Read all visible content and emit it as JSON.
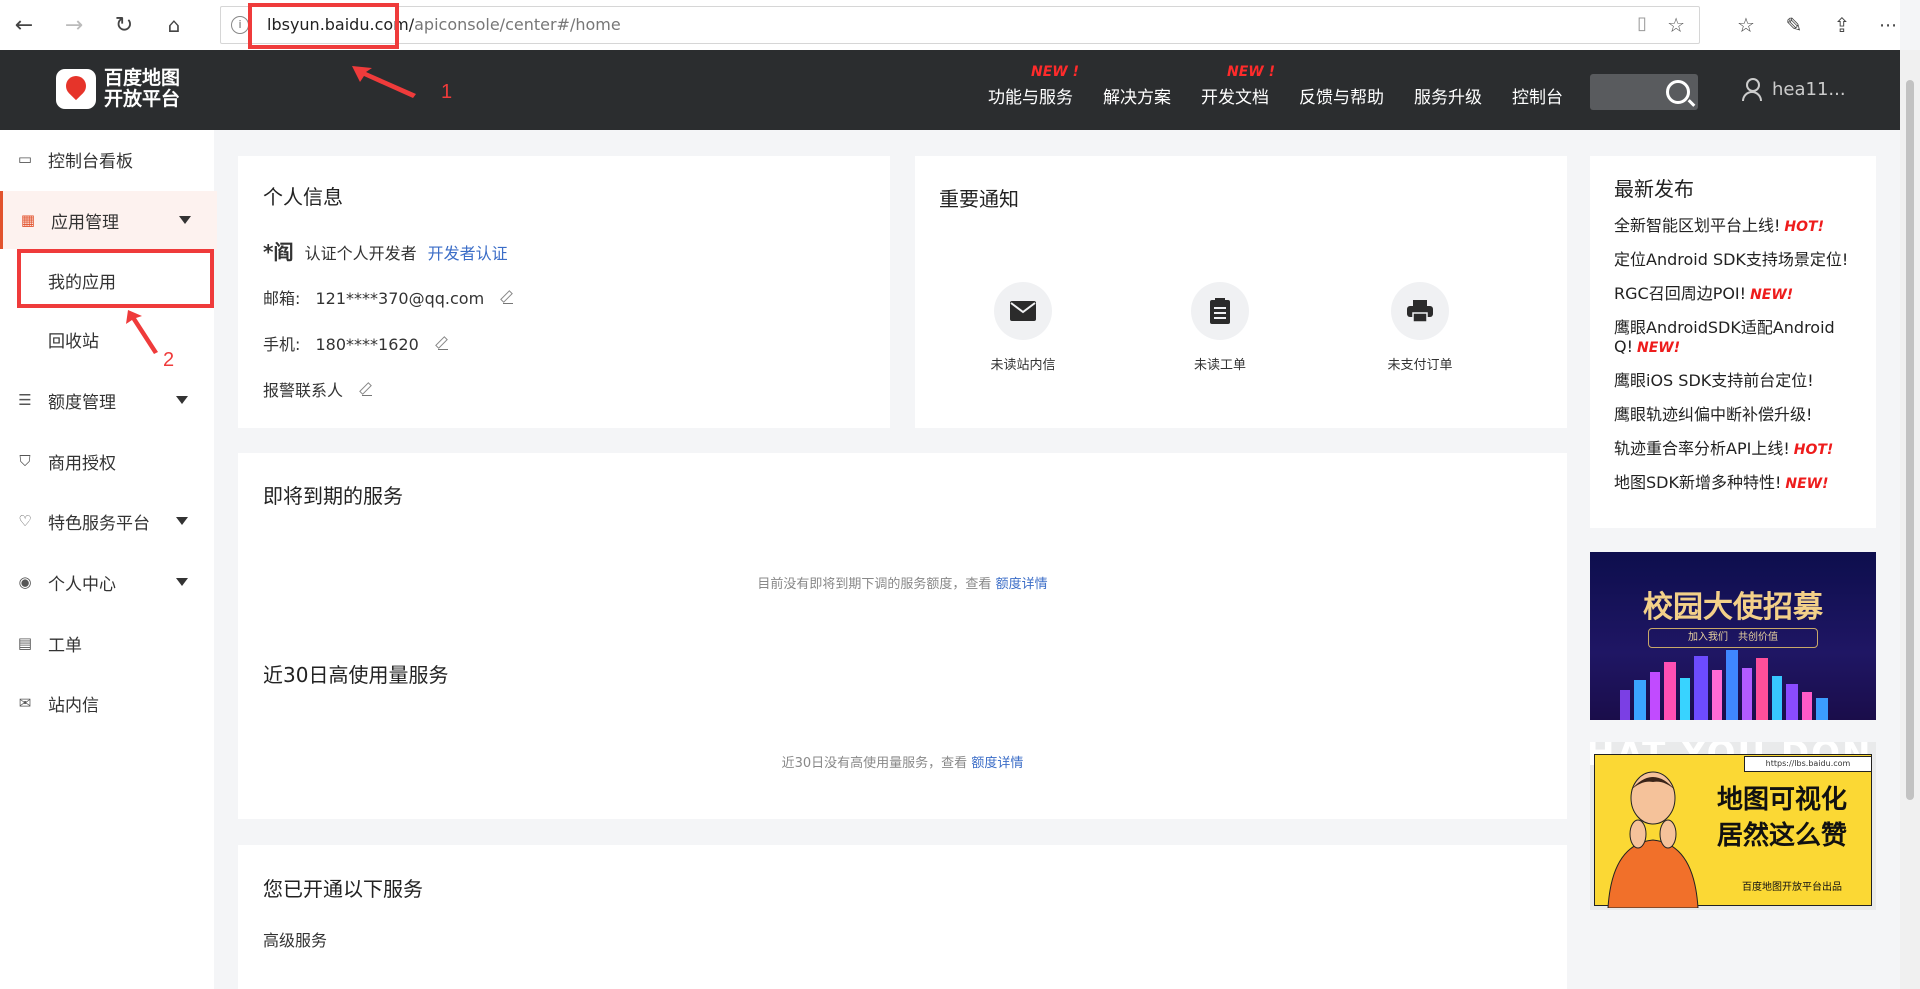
{
  "browser": {
    "url_host": "lbsyun.baidu.com/",
    "url_path": "apiconsole/center#/home",
    "info_glyph": "i"
  },
  "annotations": {
    "num1": "1",
    "num2": "2"
  },
  "header": {
    "logo_line1": "百度地图",
    "logo_line2": "开放平台",
    "nav": [
      {
        "label": "功能与服务",
        "badge": "NEW !"
      },
      {
        "label": "解决方案",
        "badge": ""
      },
      {
        "label": "开发文档",
        "badge": "NEW !"
      },
      {
        "label": "反馈与帮助",
        "badge": ""
      },
      {
        "label": "服务升级",
        "badge": ""
      },
      {
        "label": "控制台",
        "badge": ""
      }
    ],
    "username": "hea11..."
  },
  "sidebar": {
    "items": [
      {
        "label": "控制台看板",
        "icon": "id-card-icon"
      },
      {
        "label": "应用管理",
        "icon": "grid-icon"
      },
      {
        "label": "我的应用"
      },
      {
        "label": "回收站"
      },
      {
        "label": "额度管理",
        "icon": "sliders-icon"
      },
      {
        "label": "商用授权",
        "icon": "shield-icon"
      },
      {
        "label": "特色服务平台",
        "icon": "heart-icon"
      },
      {
        "label": "个人中心",
        "icon": "user-circle-icon"
      },
      {
        "label": "工单",
        "icon": "clipboard-icon"
      },
      {
        "label": "站内信",
        "icon": "mail-icon"
      }
    ]
  },
  "personal": {
    "title": "个人信息",
    "name": "*阎",
    "dev_type": "认证个人开发者",
    "dev_link": "开发者认证",
    "email_label": "邮箱:",
    "email": "121****370@qq.com",
    "phone_label": "手机:",
    "phone": "180****1620",
    "alarm_label": "报警联系人"
  },
  "notice": {
    "title": "重要通知",
    "items": [
      "未读站内信",
      "未读工单",
      "未支付订单"
    ]
  },
  "expiring": {
    "title": "即将到期的服务",
    "note": "目前没有即将到期下调的服务额度，查看",
    "link": "额度详情"
  },
  "highuse": {
    "title": "近30日高使用量服务",
    "note": "近30日没有高使用量服务，查看",
    "link": "额度详情"
  },
  "opened": {
    "title": "您已开通以下服务",
    "sub": "高级服务"
  },
  "news": {
    "title": "最新发布",
    "items": [
      {
        "text": "全新智能区划平台上线!",
        "tag": "HOT!"
      },
      {
        "text": "定位Android SDK支持场景定位!",
        "tag": ""
      },
      {
        "text": "RGC召回周边POI!",
        "tag": "NEW!"
      },
      {
        "text": "鹰眼AndroidSDK适配Android Q!",
        "tag": "NEW!"
      },
      {
        "text": "鹰眼iOS SDK支持前台定位!",
        "tag": ""
      },
      {
        "text": "鹰眼轨迹纠偏中断补偿升级!",
        "tag": ""
      },
      {
        "text": "轨迹重合率分析API上线!",
        "tag": "HOT!"
      },
      {
        "text": "地图SDK新增多种特性!",
        "tag": "NEW!"
      }
    ]
  },
  "banners": {
    "b1_title": "校园大使招募",
    "b1_sub": "加入我们　共创价值",
    "b2_url": "https://lbs.baidu.com",
    "b2_line1": "地图可视化",
    "b2_line2": "居然这么赞",
    "b2_footer": "百度地图开放平台出品",
    "b2_bg_text": "HAT YOU DON"
  },
  "colors": {
    "accent": "#e2532d",
    "link": "#3b6dc7",
    "header_bg": "#2b2d2f",
    "annotation": "#ef3b3b"
  }
}
